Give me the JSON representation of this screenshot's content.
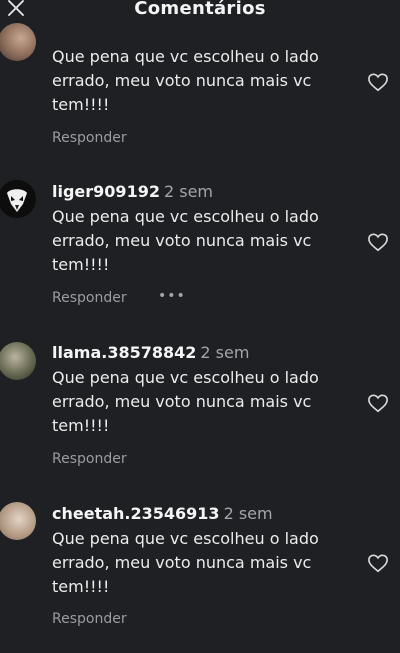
{
  "header": {
    "title": "Comentários"
  },
  "comments": [
    {
      "username": "",
      "time": "",
      "text": "Que pena que vc escolheu o lado errado, meu voto nunca mais vc tem!!!!",
      "reply_label": "Responder",
      "more": ""
    },
    {
      "username": "liger909192",
      "time": "2 sem",
      "text": "Que pena que vc escolheu o lado errado, meu voto nunca mais vc tem!!!!",
      "reply_label": "Responder",
      "more": "•••"
    },
    {
      "username": "llama.38578842",
      "time": "2 sem",
      "text": "Que pena que vc escolheu o lado errado, meu voto nunca mais vc tem!!!!",
      "reply_label": "Responder",
      "more": ""
    },
    {
      "username": "cheetah.23546913",
      "time": "2 sem",
      "text": "Que pena que vc escolheu o lado errado, meu voto nunca mais vc tem!!!!",
      "reply_label": "Responder",
      "more": ""
    }
  ],
  "icons": {
    "close": "close-icon",
    "like": "heart-icon",
    "more": "more-options-icon"
  },
  "colors": {
    "background": "#1e2024",
    "text": "#f2f2f2",
    "muted": "#9a9ca1"
  }
}
